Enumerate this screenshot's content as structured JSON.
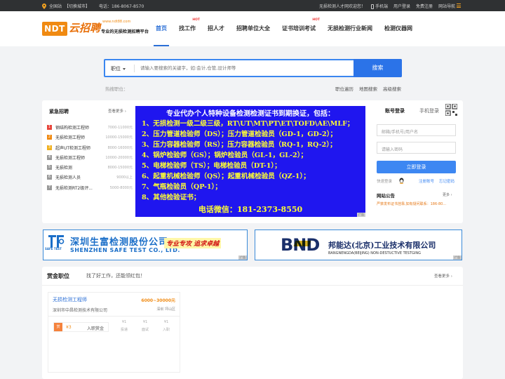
{
  "topbar": {
    "station": "全国站",
    "switch_city": "【切换城市】",
    "phone": "电话：186-8067-8570",
    "welcome": "无损检测人才网欢迎您！",
    "mobile": "手机端",
    "user_login": "用户登录",
    "free_register": "免费注册",
    "site_nav": "网站导航"
  },
  "logo": {
    "badge": "NDT",
    "name": "云招聘",
    "url": "www.ndt88.com",
    "slogan": "专业的无损检测招聘平台"
  },
  "nav": [
    {
      "label": "首页",
      "hot": ""
    },
    {
      "label": "找工作",
      "hot": "HOT"
    },
    {
      "label": "招人才",
      "hot": ""
    },
    {
      "label": "招聘单位大全",
      "hot": ""
    },
    {
      "label": "证书培训考试",
      "hot": "HOT"
    },
    {
      "label": "无损检测行业新闻",
      "hot": ""
    },
    {
      "label": "检测仪器网",
      "hot": ""
    }
  ],
  "search": {
    "category": "职位",
    "placeholder": "请输入要搜索的关键字，如:会计,仓管,设计师等",
    "button": "搜索"
  },
  "hot": {
    "label": "热搜职位：",
    "links": [
      "职位遍历",
      "地图搜索",
      "高级搜索"
    ]
  },
  "urgent": {
    "title": "紧急招聘",
    "more": "查看更多 ›",
    "items": [
      {
        "num": "1",
        "name": "钢结构检测工程师",
        "salary": "7000-11000元",
        "color": "#e8443a"
      },
      {
        "num": "2",
        "name": "无损检测工程师",
        "salary": "10000-15000元",
        "color": "#f08a12"
      },
      {
        "num": "3",
        "name": "超声UT检测工程师",
        "salary": "8000-16000元",
        "color": "#f0b020"
      },
      {
        "num": "4",
        "name": "无损检测工程师",
        "salary": "10000-20000元",
        "color": "#999999"
      },
      {
        "num": "5",
        "name": "无损检测",
        "salary": "8000-15000元",
        "color": "#999999"
      },
      {
        "num": "6",
        "name": "无损检测人员",
        "salary": "9000以上",
        "color": "#999999"
      },
      {
        "num": "7",
        "name": "无损检测RT2级评...",
        "salary": "5000-8000元",
        "color": "#999999"
      }
    ]
  },
  "banner": {
    "title": "专业代办个人特种设备检测检测证书到期换证，包括：",
    "lines": [
      "1、无损检测一级二级三级，RT\\UT\\MT\\PT\\ET\\TOFD\\AE\\MLF；",
      "2、压力管道检验师（DS）；压力管道检验员（GD-1，GD-2）；",
      "3、压力容器检验师（RS）；压力容器检验员（RQ-1，RQ-2）；",
      "4、锅炉检验师（GS）；锅炉检验员（GL-1，GL-2）；",
      "5、电梯检验师（TS）；电梯检验员（DT-1）；",
      "6、起重机械检验师（QS）；起重机械检验员（QZ-1）；",
      "7、气瓶检验员（QP-1）；",
      "8、其他检验证书；"
    ],
    "contact": "电话微信：181-2373-8550",
    "ad": "广告"
  },
  "login": {
    "tab_account": "账号登录",
    "tab_phone": "手机登录",
    "username_placeholder": "邮箱/手机号/用户名",
    "password_placeholder": "请输入密码",
    "button": "立即登录",
    "quick": "快速登录",
    "register": "注册账号",
    "forgot": "忘记密码"
  },
  "notice": {
    "title": "网站公告",
    "more": "更多 ›",
    "item": "严禁发布证书挂靠,如有疑问联系：186-80..."
  },
  "ads": {
    "a_cn": "深圳生富检测股份公司",
    "a_en": "SHENZHEN SAFE TEST CO., LTD.",
    "a_logo_text": "SAFE TEST",
    "a_slogan": "专业专攻 追求卓越",
    "b_logo": "BND",
    "b_cn": "邦能达(北京)工业技术有限公司",
    "b_en": "BANGNENGDA(BEIJING) NON-DESTUCTIVE TESTGING",
    "tag": "广告"
  },
  "reward": {
    "title": "赏金职位",
    "subtitle": "找了好工作，还能领红包！",
    "more": "查看更多 ›",
    "job": {
      "title": "无损检测工程师",
      "salary": "6000~30000元",
      "company": "深圳市中昌检测技术有限公司",
      "location": "深圳 坪山区",
      "stats": [
        {
          "value": "¥1",
          "label": "投递"
        },
        {
          "value": "¥1",
          "label": "面试"
        },
        {
          "value": "¥1",
          "label": "入职"
        }
      ],
      "bonus_value": "¥3",
      "bonus_label": "入职赏金",
      "bonus_icon": "赏"
    }
  }
}
